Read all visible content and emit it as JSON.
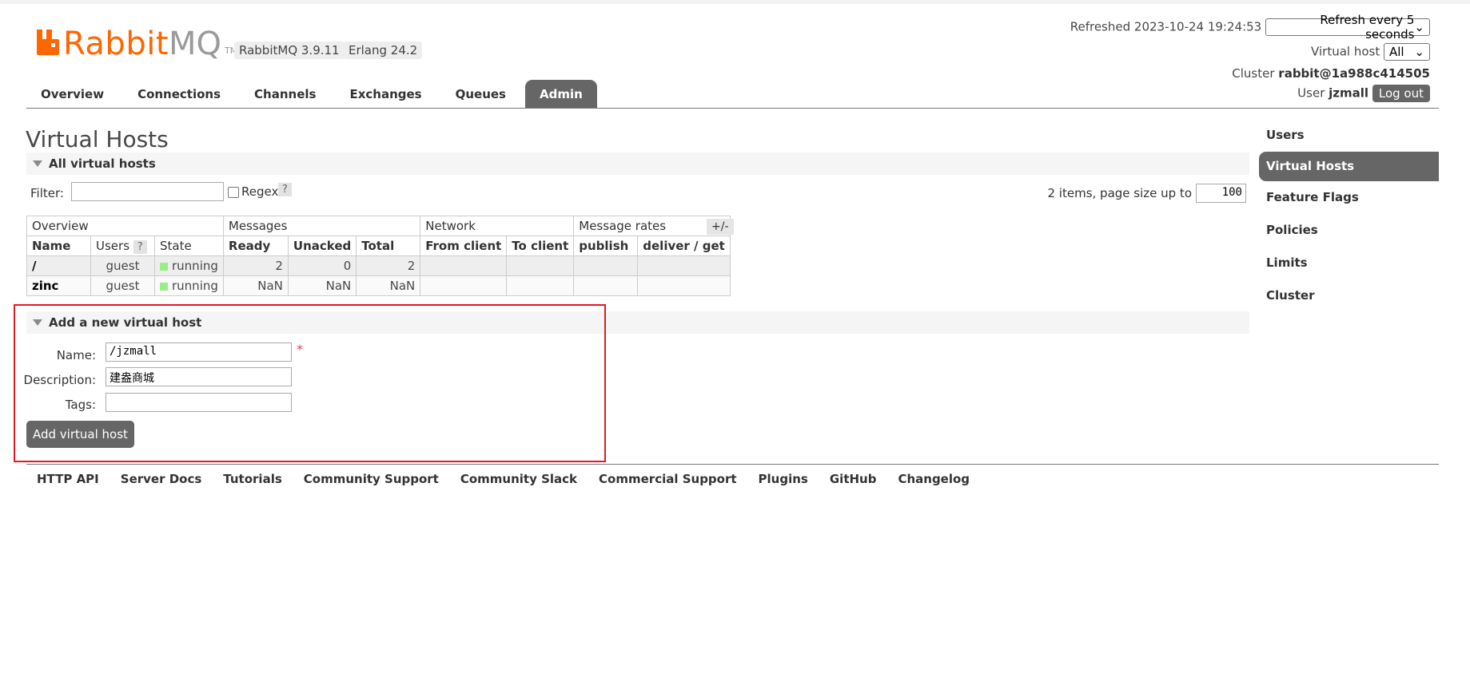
{
  "brand": {
    "name_rabbit": "Rabbit",
    "name_mq": "MQ",
    "tm": "TM",
    "version": "RabbitMQ 3.9.11",
    "erlang": "Erlang 24.2",
    "color": "#ff6600"
  },
  "header": {
    "refreshed_label": "Refreshed 2023-10-24 19:24:53",
    "refresh_select": "Refresh every 5 seconds",
    "vhost_label": "Virtual host",
    "vhost_select": "All",
    "cluster_label": "Cluster",
    "cluster_value": "rabbit@1a988c414505",
    "user_label": "User",
    "user_value": "jzmall",
    "logout": "Log out"
  },
  "tabs": [
    "Overview",
    "Connections",
    "Channels",
    "Exchanges",
    "Queues",
    "Admin"
  ],
  "active_tab": "Admin",
  "page_title": "Virtual Hosts",
  "all_section": {
    "title": "All virtual hosts",
    "filter_label": "Filter:",
    "regex_label": "Regex",
    "help": "?",
    "pagination": "2 items, page size up to",
    "page_size": "100",
    "plusminus": "+/-"
  },
  "table": {
    "groups": [
      "Overview",
      "Messages",
      "Network",
      "Message rates"
    ],
    "columns": [
      "Name",
      "Users",
      "State",
      "Ready",
      "Unacked",
      "Total",
      "From client",
      "To client",
      "publish",
      "deliver / get"
    ],
    "users_help": "?",
    "rows": [
      {
        "name": "/",
        "users": "guest",
        "state": "running",
        "ready": "2",
        "unacked": "0",
        "total": "2"
      },
      {
        "name": "zinc",
        "users": "guest",
        "state": "running",
        "ready": "NaN",
        "unacked": "NaN",
        "total": "NaN"
      }
    ],
    "running_color": "#99ee88"
  },
  "add_section": {
    "title": "Add a new virtual host",
    "name_label": "Name:",
    "name_value": "/jzmall",
    "required": "*",
    "desc_label": "Description:",
    "desc_value": "建盎商城",
    "tags_label": "Tags:",
    "tags_value": "",
    "button": "Add virtual host",
    "highlight_color": "#e21a26"
  },
  "footer": [
    "HTTP API",
    "Server Docs",
    "Tutorials",
    "Community Support",
    "Community Slack",
    "Commercial Support",
    "Plugins",
    "GitHub",
    "Changelog"
  ],
  "right_nav": [
    "Users",
    "Virtual Hosts",
    "Feature Flags",
    "Policies",
    "Limits",
    "Cluster"
  ],
  "right_nav_active": "Virtual Hosts"
}
